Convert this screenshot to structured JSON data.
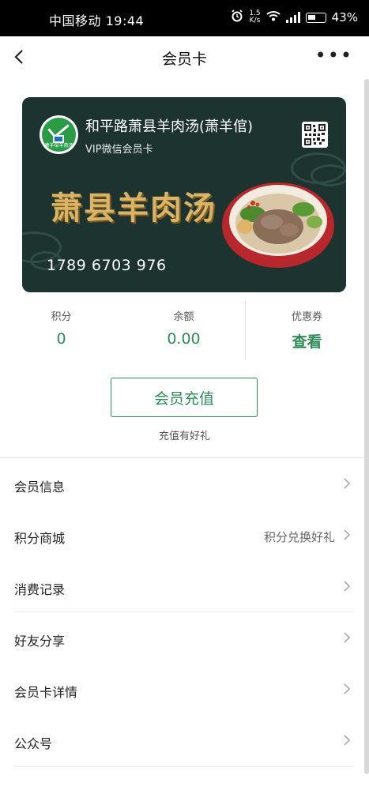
{
  "status_bar": {
    "carrier_time": "中国移动 19:44",
    "net_speed_top": "1.5",
    "net_speed_unit": "K/s",
    "battery": "43%"
  },
  "nav": {
    "title": "会员卡",
    "more": "•••"
  },
  "card": {
    "store_name": "和平路萧县羊肉汤(萧羊倌)",
    "card_label": "VIP微信会员卡",
    "headline": "萧县羊肉汤",
    "card_number": "1789 6703 976",
    "logo_text": "萧羊倌羊肉汤",
    "colors": {
      "background": "#1d332f",
      "headline": "#d9b466"
    }
  },
  "stats": [
    {
      "label": "积分",
      "value": "0"
    },
    {
      "label": "余额",
      "value": "0.00"
    },
    {
      "label": "优惠券",
      "value": "查看"
    }
  ],
  "recharge": {
    "button_label": "会员充值",
    "tip": "充值有好礼"
  },
  "menu": [
    {
      "label": "会员信息",
      "extra": ""
    },
    {
      "label": "积分商城",
      "extra": "积分兑换好礼"
    },
    {
      "label": "消费记录",
      "extra": ""
    },
    {
      "label": "好友分享",
      "extra": ""
    },
    {
      "label": "会员卡详情",
      "extra": ""
    },
    {
      "label": "公众号",
      "extra": ""
    }
  ],
  "accent_color": "#2e8b57"
}
